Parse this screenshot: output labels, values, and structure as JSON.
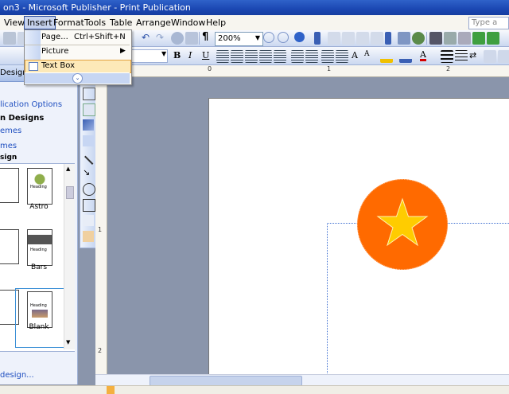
{
  "window": {
    "title": "on3 - Microsoft Publisher - Print Publication"
  },
  "menubar": {
    "items": [
      "View",
      "Insert",
      "Format",
      "Tools",
      "Table",
      "Arrange",
      "Window",
      "Help"
    ],
    "help_placeholder": "Type a qu"
  },
  "toolbar": {
    "zoom_value": "200%"
  },
  "insert_menu": {
    "page_label": "Page...",
    "page_shortcut": "Ctrl+Shift+N",
    "picture_label": "Picture",
    "textbox_label": "Text Box"
  },
  "task_pane": {
    "header": "Design",
    "links": [
      "lication Options",
      "n Designs",
      "emes",
      "mes"
    ],
    "section_label": "sign",
    "design_items": [
      "Astro",
      "Bars",
      "Blank"
    ],
    "thumb_heading": "Heading",
    "footer_link": "design..."
  },
  "rulers": {
    "top": [
      "0",
      "1",
      "2"
    ],
    "left": [
      "1",
      "2"
    ]
  },
  "colors": {
    "shape_fill": "#ff6a00",
    "star_fill": "#ffcc00",
    "selection": "#e2a23f"
  },
  "icons": [
    "star-shape",
    "circle-shape",
    "insert-menu-expand"
  ]
}
